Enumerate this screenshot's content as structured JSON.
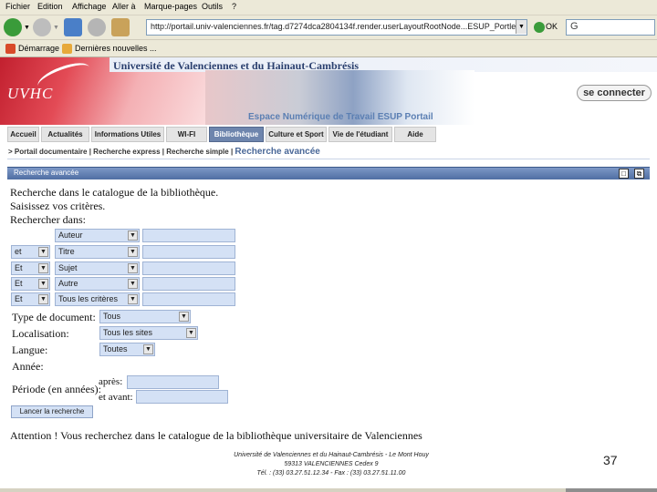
{
  "menu": [
    "Fichier",
    "Edition",
    "Affichage",
    "Aller à",
    "Marque-pages",
    "Outils",
    "?"
  ],
  "toolbar": {
    "address": "http://portail.univ-valenciennes.fr/tag.d7274dca2804134f.render.userLayoutRootNode...ESUP_Portlet_uPortal_...",
    "go_label": "OK",
    "search_value": "G"
  },
  "links_bar": [
    "Démarrage",
    "Dernières nouvelles ..."
  ],
  "header": {
    "university": "Université de Valenciennes et du Hainaut-Cambrésis",
    "logo_text": "UVHC",
    "ent_title": "Espace Numérique de Travail ESUP Portail",
    "connect_label": "se connecter"
  },
  "tabs": [
    "Accueil",
    "Actualités",
    "Informations Utiles",
    "WI-FI",
    "Bibliothèque",
    "Culture et Sport",
    "Vie de l'étudiant",
    "Aide"
  ],
  "subnav": {
    "prefix": ">",
    "items": [
      "Portail documentaire",
      "Recherche express",
      "Recherche simple"
    ],
    "current": "Recherche avancée"
  },
  "channel": {
    "title": "Recherche avancée"
  },
  "form": {
    "intro": [
      "Recherche dans le catalogue de la bibliothèque.",
      "Saisissez vos critères.",
      "Rechercher dans:"
    ],
    "rows": [
      {
        "op": "",
        "field": "Auteur"
      },
      {
        "op": "et",
        "field": "Titre"
      },
      {
        "op": "Et",
        "field": "Sujet"
      },
      {
        "op": "Et",
        "field": "Autre"
      },
      {
        "op": "Et",
        "field": "Tous les critères"
      }
    ],
    "doc_type_label": "Type de document:",
    "doc_type_value": "Tous",
    "location_label": "Localisation:",
    "location_value": "Tous les sites",
    "language_label": "Langue:",
    "language_value": "Toutes",
    "year_label": "Année:",
    "period_label": "Période (en années):",
    "after_label": "après:",
    "before_label": "et avant:",
    "submit_label": "Lancer la recherche",
    "attention": "Attention ! Vous recherchez dans le catalogue de la bibliothèque universitaire de Valenciennes"
  },
  "footer": {
    "address": [
      "Université de Valenciennes et du Hainaut-Cambrésis - Le Mont Houy",
      "59313 VALENCIENNES Cedex 9",
      "Tél. : (33) 03.27.51.12.34 - Fax : (33) 03.27.51.11.00"
    ],
    "page_number": "37"
  }
}
